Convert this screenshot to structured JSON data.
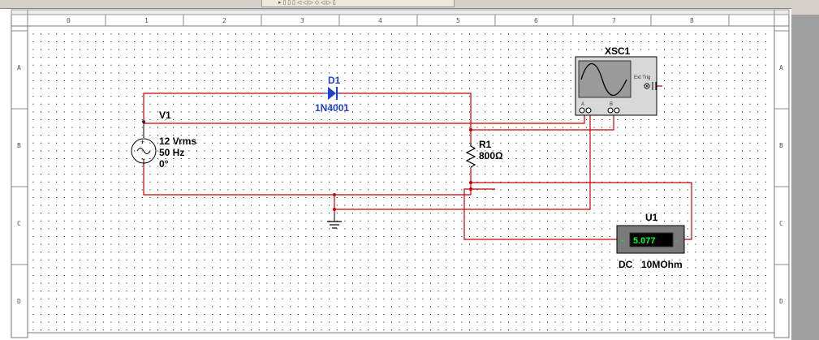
{
  "toolbar": {
    "partial_label": "▸ ▯ ▯ ▯ ◁ ◁ ▷ ◇ ◁ ▷ ▯"
  },
  "ruler": {
    "top": [
      "0",
      "1",
      "2",
      "3",
      "4",
      "5",
      "6",
      "7",
      "8"
    ],
    "left": [
      "A",
      "B",
      "C",
      "D"
    ],
    "right": [
      "A",
      "B",
      "C",
      "D"
    ]
  },
  "components": {
    "source": {
      "name": "V1",
      "voltage": "12 Vrms",
      "frequency": "50 Hz",
      "phase": "0°"
    },
    "diode": {
      "name": "D1",
      "model": "1N4001"
    },
    "resistor": {
      "name": "R1",
      "value": "800Ω"
    },
    "oscilloscope": {
      "name": "XSC1",
      "channel_a": "A",
      "channel_b": "B",
      "ext_trig": "Ext Trig"
    },
    "multimeter": {
      "name": "U1",
      "reading": "5.077",
      "mode": "DC",
      "impedance": "10MOhm"
    }
  },
  "colors": {
    "wire": "#cc0000",
    "diode": "#1f3fd0",
    "junction": "#cc0000",
    "grid_dot": "#000000",
    "mm_screen": "#000000",
    "mm_text": "#00ff33"
  }
}
